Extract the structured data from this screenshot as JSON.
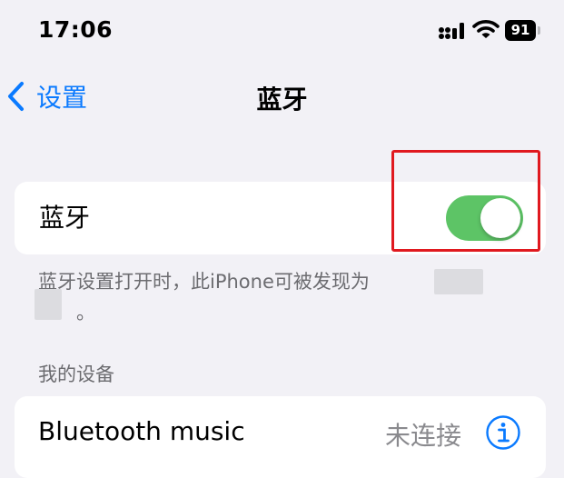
{
  "status_bar": {
    "time": "17:06",
    "battery_level": "91",
    "icons": [
      "cellular-signal-icon",
      "wifi-icon",
      "battery-icon"
    ]
  },
  "nav": {
    "back_label": "设置",
    "title": "蓝牙"
  },
  "bluetooth": {
    "label": "蓝牙",
    "toggle_on": true,
    "toggle_color": "#5dc466"
  },
  "footer": {
    "note": "蓝牙设置打开时，此iPhone可被发现为",
    "note_end": "。"
  },
  "devices_section": {
    "header": "我的设备",
    "items": [
      {
        "name": "Bluetooth music",
        "status": "未连接"
      }
    ]
  },
  "colors": {
    "accent": "#0a7aff",
    "highlight": "#e0191f",
    "background": "#f2f1f6"
  }
}
